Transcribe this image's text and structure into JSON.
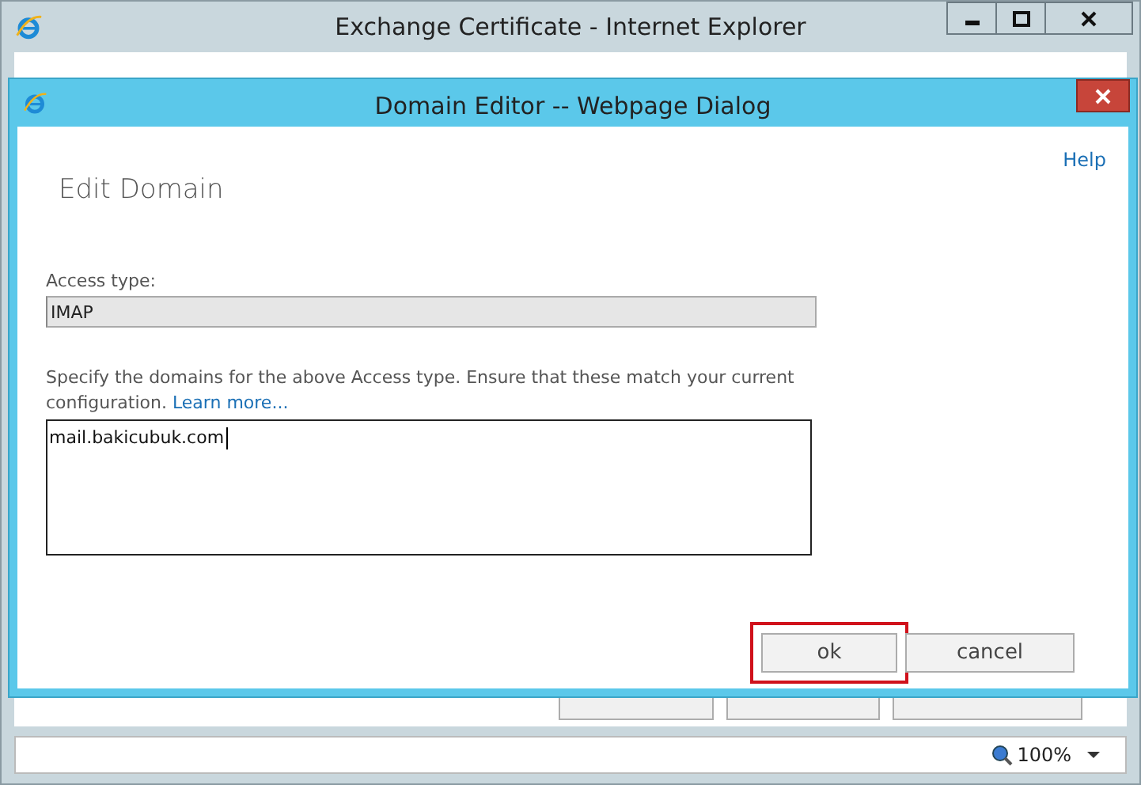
{
  "window": {
    "title": "Exchange Certificate - Internet Explorer",
    "controls": [
      {
        "kind": "minimize"
      },
      {
        "kind": "maximize"
      },
      {
        "kind": "close"
      }
    ]
  },
  "background_buttons": [
    {
      "kind": "button"
    },
    {
      "kind": "button"
    },
    {
      "kind": "button"
    }
  ],
  "dialog": {
    "title": "Domain Editor -- Webpage Dialog",
    "help": "Help",
    "heading": "Edit Domain",
    "access_type": {
      "label": "Access type:",
      "value": "IMAP",
      "disabled": true
    },
    "description": "Specify the domains for the above Access type. Ensure that these match your current configuration.",
    "learn_more": "Learn more...",
    "domains": {
      "value": "mail.bakicubuk.com"
    },
    "buttons": [
      {
        "label": "ok",
        "highlighted": true
      },
      {
        "label": "cancel",
        "highlighted": false
      }
    ]
  },
  "status_bar": {
    "zoom": "100%"
  }
}
